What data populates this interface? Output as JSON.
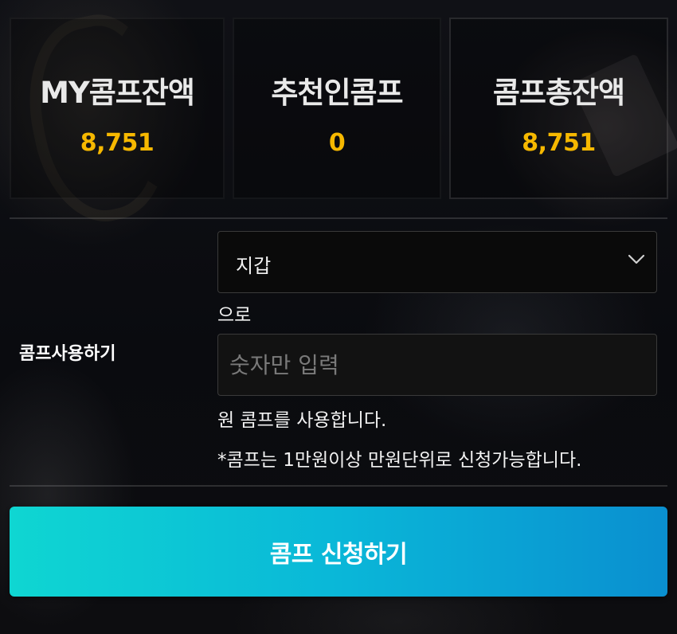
{
  "stats": [
    {
      "label": "MY콤프잔액",
      "value": "8,751"
    },
    {
      "label": "추천인콤프",
      "value": "0"
    },
    {
      "label": "콤프총잔액",
      "value": "8,751"
    }
  ],
  "comp_use": {
    "label": "콤프사용하기",
    "wallet_select": {
      "selected": "지갑"
    },
    "suffix_text": "으로",
    "amount_input": {
      "value": "",
      "placeholder": "숫자만 입력"
    },
    "use_text": "원 콤프를 사용합니다.",
    "note": "*콤프는 1만원이상 만원단위로 신청가능합니다."
  },
  "submit_button": {
    "label": "콤프 신청하기"
  },
  "colors": {
    "accent_value": "#f6b800",
    "button_gradient_start": "#0fd6d2",
    "button_gradient_end": "#0a8fd0"
  },
  "icons": {
    "select_arrow": "chevron-down-icon"
  }
}
